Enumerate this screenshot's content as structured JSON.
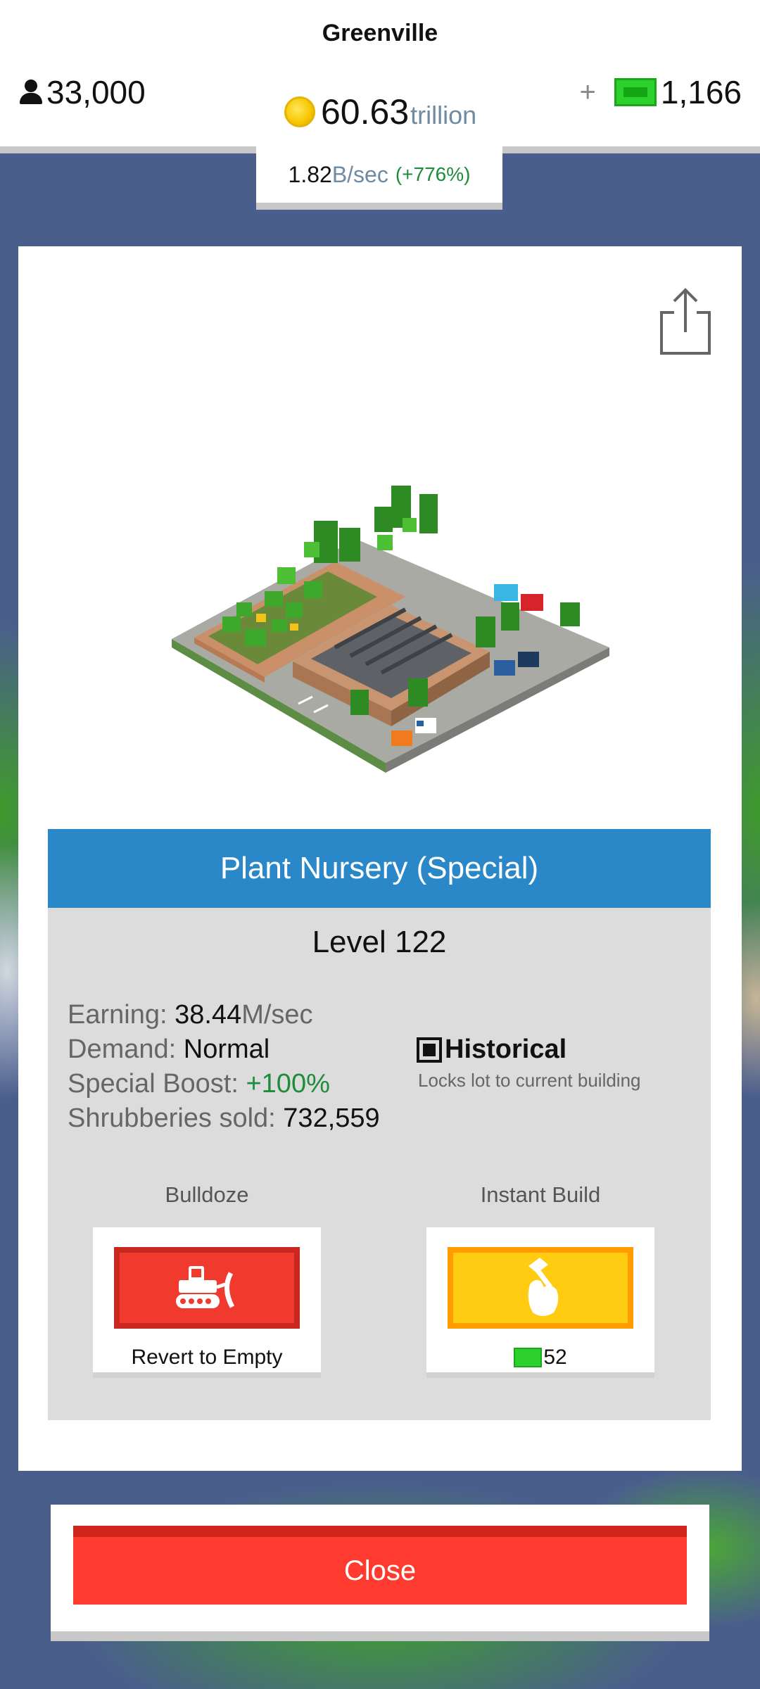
{
  "header": {
    "city_name": "Greenville",
    "population": "33,000",
    "coins_value": "60.63",
    "coins_unit": "trillion",
    "cash_plus": "+",
    "cash_value": "1,166",
    "rate_value": "1.82",
    "rate_unit": "B/sec",
    "rate_boost": "(+776%)"
  },
  "building": {
    "title": "Plant Nursery (Special)",
    "level": "Level 122",
    "stats": {
      "earning_label": "Earning:",
      "earning_value": "38.44",
      "earning_unit": "M/sec",
      "demand_label": "Demand:",
      "demand_value": "Normal",
      "boost_label": "Special Boost:",
      "boost_value": "+100%",
      "sold_label": "Shrubberies sold:",
      "sold_value": "732,559"
    },
    "historical": {
      "label": "Historical",
      "checked": true,
      "description": "Locks lot to current building"
    }
  },
  "actions": {
    "bulldoze_label": "Bulldoze",
    "bulldoze_sub": "Revert to Empty",
    "instant_label": "Instant Build",
    "instant_cost": "52"
  },
  "close_label": "Close",
  "icons": {
    "population": "person-icon",
    "coins": "coin-icon",
    "cash": "cash-icon",
    "share": "share-icon",
    "historical": "checkbox-icon",
    "bulldoze": "bulldozer-icon",
    "instant": "hammer-hand-icon"
  },
  "colors": {
    "title_bar": "#2a88c8",
    "bulldoze_button": "#f03a2e",
    "instant_button": "#ffcc12",
    "close_button": "#ff3b2f",
    "positive_text": "#1e8c3a",
    "cash_green": "#2dd12d",
    "background": "#4a5e8c"
  }
}
